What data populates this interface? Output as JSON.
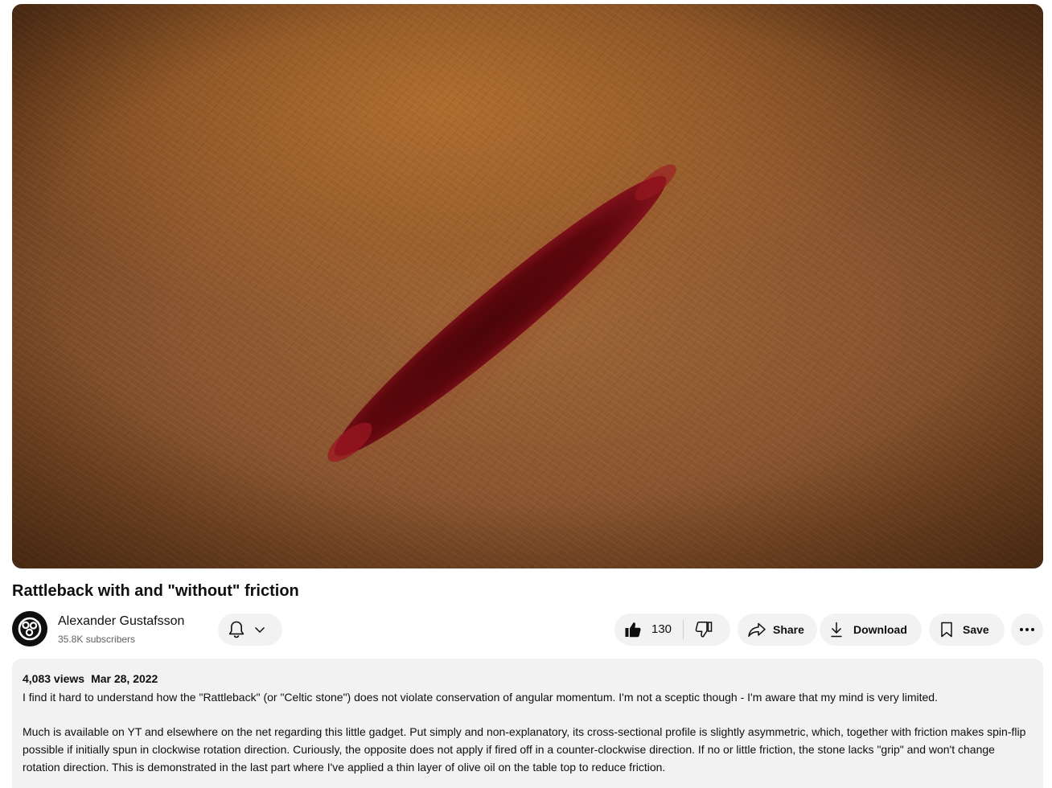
{
  "video": {
    "title": "Rattleback with and \"without\" friction"
  },
  "channel": {
    "name": "Alexander Gustafsson",
    "subscribers": "35.8K subscribers",
    "avatar_icon": "film-reel-logo"
  },
  "actions": {
    "subscribe_bell_icon": "bell-icon",
    "like_count": "130",
    "share_label": "Share",
    "download_label": "Download",
    "save_label": "Save",
    "more_icon": "more-horizontal-icon"
  },
  "description": {
    "views": "4,083 views",
    "date": "Mar 28, 2022",
    "paragraph1": "I find it hard to understand how the \"Rattleback\" (or \"Celtic stone\") does not violate conservation of angular momentum. I'm not a sceptic though - I'm aware that my mind is very limited.",
    "paragraph2": "Much is available on YT and elsewhere on the net regarding this little gadget. Put simply and non-explanatory, its cross-sectional profile is slightly asymmetric, which, together with friction makes spin-flip possible if initially spun in clockwise rotation direction. Curiously, the opposite does not apply if fired off in a counter-clockwise direction. If no or little friction, the stone lacks \"grip\" and won't change rotation direction. This is demonstrated in the last part where I've applied a thin layer of olive oil on the table top to reduce friction."
  },
  "colors": {
    "pill_bg": "#f2f2f2",
    "text": "#0f0f0f",
    "secondary_text": "#606060"
  }
}
